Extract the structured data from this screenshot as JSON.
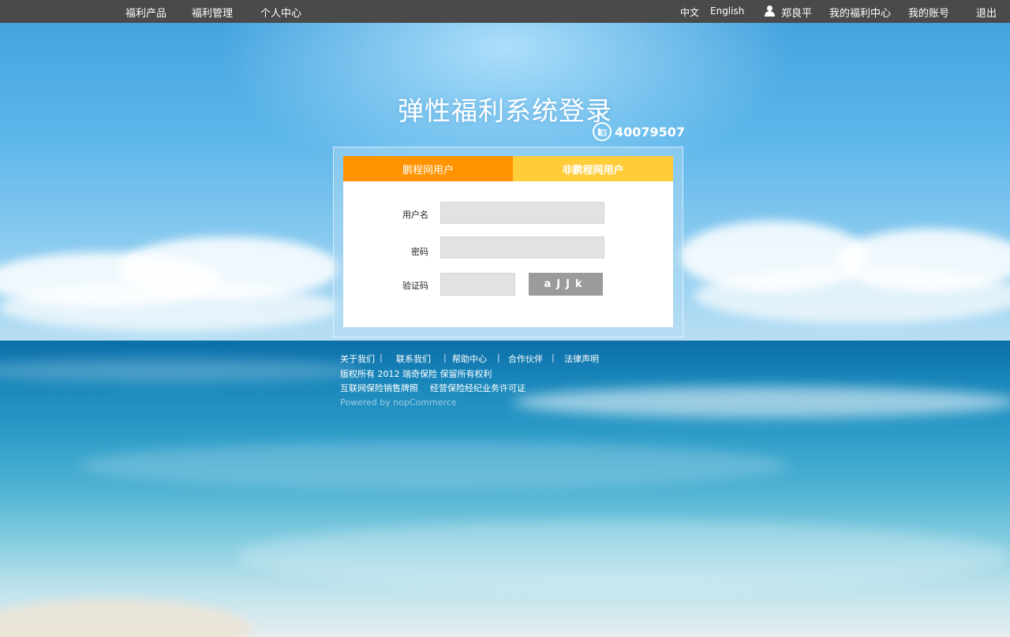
{
  "nav": {
    "left": [
      "福利产品",
      "福利管理",
      "个人中心"
    ],
    "lang_zh": "中文",
    "lang_en": "English",
    "user_name": "郑良平",
    "my_welfare": "我的福利中心",
    "my_account": "我的账号",
    "logout": "退出"
  },
  "login": {
    "title": "弹性福利系统登录",
    "phone": "40079507",
    "tabs": [
      "鹏程网用户",
      "非鹏程网用户"
    ],
    "username_label": "用户名",
    "password_label": "密码",
    "captcha_label": "验证码",
    "username_value": "",
    "password_value": "",
    "captcha_value": "",
    "captcha_image_text": "aJJk"
  },
  "footer": {
    "links": [
      "关于我们",
      "联系我们",
      "帮助中心",
      "合作伙伴",
      "法律声明"
    ],
    "separator": "|",
    "copyright": "版权所有  2012 瑞奇保险 保留所有权利",
    "license_1": "互联网保险销售牌照",
    "license_2": "经营保险经纪业务许可证",
    "powered": "Powered by nopCommerce"
  },
  "colors": {
    "topbar": "#4a4a4a",
    "tab_active": "#ff9300",
    "tab_inactive": "#ffcc3a",
    "captcha_bg": "#9b9b9b"
  }
}
